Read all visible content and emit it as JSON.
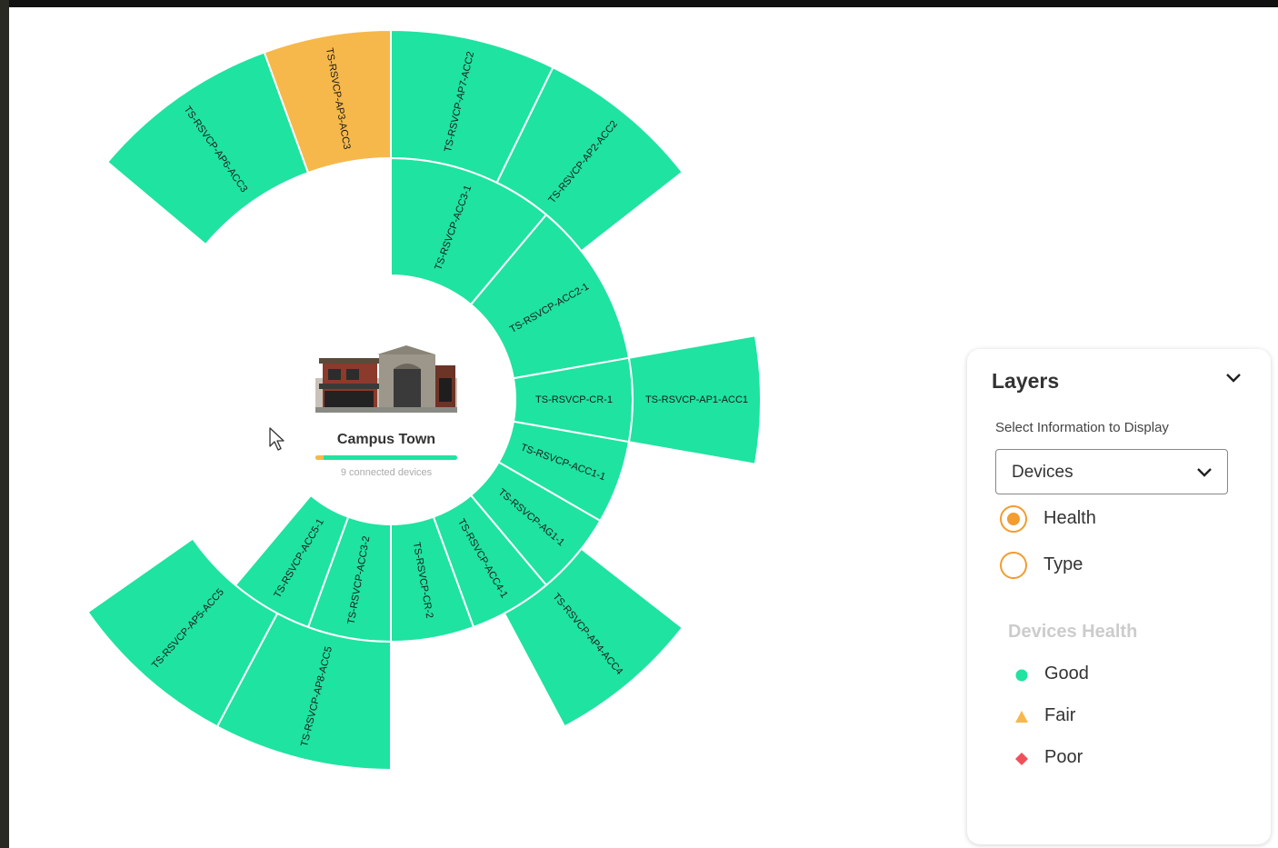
{
  "chart_data": {
    "type": "sunburst",
    "center": {
      "title": "Campus Town",
      "subtitle": "9 connected devices"
    },
    "rings": [
      {
        "level": 1,
        "segments": [
          {
            "label": "TS-RSVCP-ACC3-1",
            "health": "Good",
            "start_deg": 0,
            "end_deg": 40
          },
          {
            "label": "TS-RSVCP-ACC2-1",
            "health": "Good",
            "start_deg": 40,
            "end_deg": 80
          },
          {
            "label": "TS-RSVCP-CR-1",
            "health": "Good",
            "start_deg": 80,
            "end_deg": 100
          },
          {
            "label": "TS-RSVCP-ACC1-1",
            "health": "Good",
            "start_deg": 100,
            "end_deg": 120
          },
          {
            "label": "TS-RSVCP-AG1-1",
            "health": "Good",
            "start_deg": 120,
            "end_deg": 140
          },
          {
            "label": "TS-RSVCP-ACC4-1",
            "health": "Good",
            "start_deg": 140,
            "end_deg": 160
          },
          {
            "label": "TS-RSVCP-CR-2",
            "health": "Good",
            "start_deg": 160,
            "end_deg": 180
          },
          {
            "label": "TS-RSVCP-ACC3-2",
            "health": "Good",
            "start_deg": 180,
            "end_deg": 200
          },
          {
            "label": "TS-RSVCP-ACC5-1",
            "health": "Good",
            "start_deg": 200,
            "end_deg": 220
          }
        ]
      },
      {
        "level": 2,
        "segments": [
          {
            "label": "TS-RSVCP-AP6-ACC3",
            "health": "Good",
            "start_deg": -50,
            "end_deg": -20
          },
          {
            "label": "TS-RSVCP-AP3-ACC3",
            "health": "Fair",
            "start_deg": -20,
            "end_deg": 0
          },
          {
            "label": "TS-RSVCP-AP7-ACC2",
            "health": "Good",
            "start_deg": 0,
            "end_deg": 26
          },
          {
            "label": "TS-RSVCP-AP2-ACC2",
            "health": "Good",
            "start_deg": 26,
            "end_deg": 52
          },
          {
            "label": "TS-RSVCP-AP1-ACC1",
            "health": "Good",
            "start_deg": 80,
            "end_deg": 100
          },
          {
            "label": "TS-RSVCP-AP4-ACC4",
            "health": "Good",
            "start_deg": 128,
            "end_deg": 152
          },
          {
            "label": "TS-RSVCP-AP8-ACC5",
            "health": "Good",
            "start_deg": 180,
            "end_deg": 208
          },
          {
            "label": "TS-RSVCP-AP5-ACC5",
            "health": "Good",
            "start_deg": 208,
            "end_deg": 235
          }
        ]
      }
    ],
    "health_colors": {
      "Good": "#1fe3a0",
      "Fair": "#f6b84a",
      "Poor": "#f0505a"
    }
  },
  "campus": {
    "title": "Campus Town",
    "device_count_text": "9 connected devices",
    "fair_fraction": 0.06
  },
  "layers_panel": {
    "title": "Layers",
    "collapse_icon": "chevron-down-icon",
    "select_label": "Select Information to Display",
    "select_value": "Devices",
    "radio_options": [
      {
        "label": "Health",
        "selected": true
      },
      {
        "label": "Type",
        "selected": false
      }
    ],
    "legend_title": "Devices Health",
    "legend": [
      {
        "label": "Good",
        "icon": "circle",
        "color": "#1fe3a0"
      },
      {
        "label": "Fair",
        "icon": "triangle",
        "color": "#f6b84a"
      },
      {
        "label": "Poor",
        "icon": "diamond",
        "color": "#f0505a"
      }
    ]
  }
}
